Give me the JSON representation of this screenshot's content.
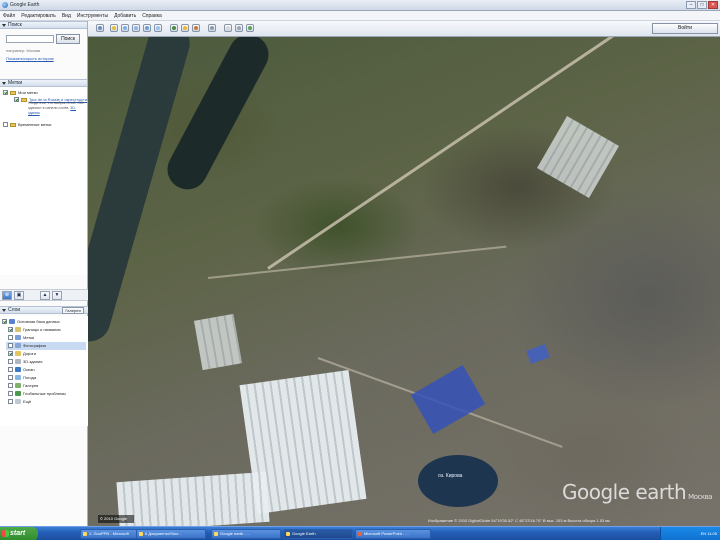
{
  "window": {
    "title": "Google Earth"
  },
  "window_buttons": {
    "minimize": "–",
    "maximize": "□",
    "close": "✕"
  },
  "menu": [
    "Файл",
    "Редактировать",
    "Вид",
    "Инструменты",
    "Добавить",
    "Справка"
  ],
  "search": {
    "header": "Поиск",
    "input_value": "",
    "button": "Поиск",
    "example": "например: Москва",
    "history_link": "Показать/скрыть историю"
  },
  "places": {
    "header": "Метки",
    "items": [
      {
        "label": "Мои метки"
      },
      {
        "label": "Tour de la Russie и окрестности"
      },
      {
        "label": "Временные метки"
      }
    ],
    "description": "Убедитесь, что выбран слой «3D-здания» в панели слоёв.",
    "description_link": "3D-здания"
  },
  "toolbar_buttons": [
    "⊕",
    "▣",
    "▲",
    "▼"
  ],
  "layers": {
    "header": "Слои",
    "gallery_button": "Галерея",
    "items": [
      {
        "label": "Основная база данных",
        "selected": false,
        "color": "#5b7fd1"
      },
      {
        "label": "Границы и названия",
        "selected": false,
        "color": "#d8c36a"
      },
      {
        "label": "Метки",
        "selected": false,
        "color": "#7aa0d8"
      },
      {
        "label": "Фотографии",
        "selected": true,
        "color": "#88a6d4"
      },
      {
        "label": "Дороги",
        "selected": false,
        "color": "#e3c55e"
      },
      {
        "label": "3D-здания",
        "selected": false,
        "color": "#b0b6c0"
      },
      {
        "label": "Океан",
        "selected": false,
        "color": "#3a78c4"
      },
      {
        "label": "Погода",
        "selected": false,
        "color": "#86b7e6"
      },
      {
        "label": "Галерея",
        "selected": false,
        "color": "#7fb36a"
      },
      {
        "label": "Глобальные проблемы",
        "selected": false,
        "color": "#4c9a4c"
      },
      {
        "label": "Ещё",
        "selected": false,
        "color": "#c2c8d2"
      }
    ]
  },
  "map_toolbar": {
    "auth_button": "Войти"
  },
  "map": {
    "lake_label": "оз. Кирова",
    "watermark": "Google earth",
    "watermark_suffix": "Москва",
    "image_year": "© 2010 Google",
    "status": "Изображение © 2010 DigitalGlobe   54°19'30.52\" С  48°23'16.70\" В   выс. 153 м   Высота обзора 1.53 км"
  },
  "taskbar": {
    "start": "start",
    "tasks": [
      {
        "label": "1. GooPPB - Microsoft",
        "active": false
      },
      {
        "label": "6 Документы/Stoo...",
        "active": false
      },
      {
        "label": "Google earth - ...",
        "active": false
      },
      {
        "label": "Google Earth",
        "active": true
      },
      {
        "label": "Microsoft PowerPoint - ...",
        "active": false
      }
    ],
    "clock": "EN  11:05"
  }
}
